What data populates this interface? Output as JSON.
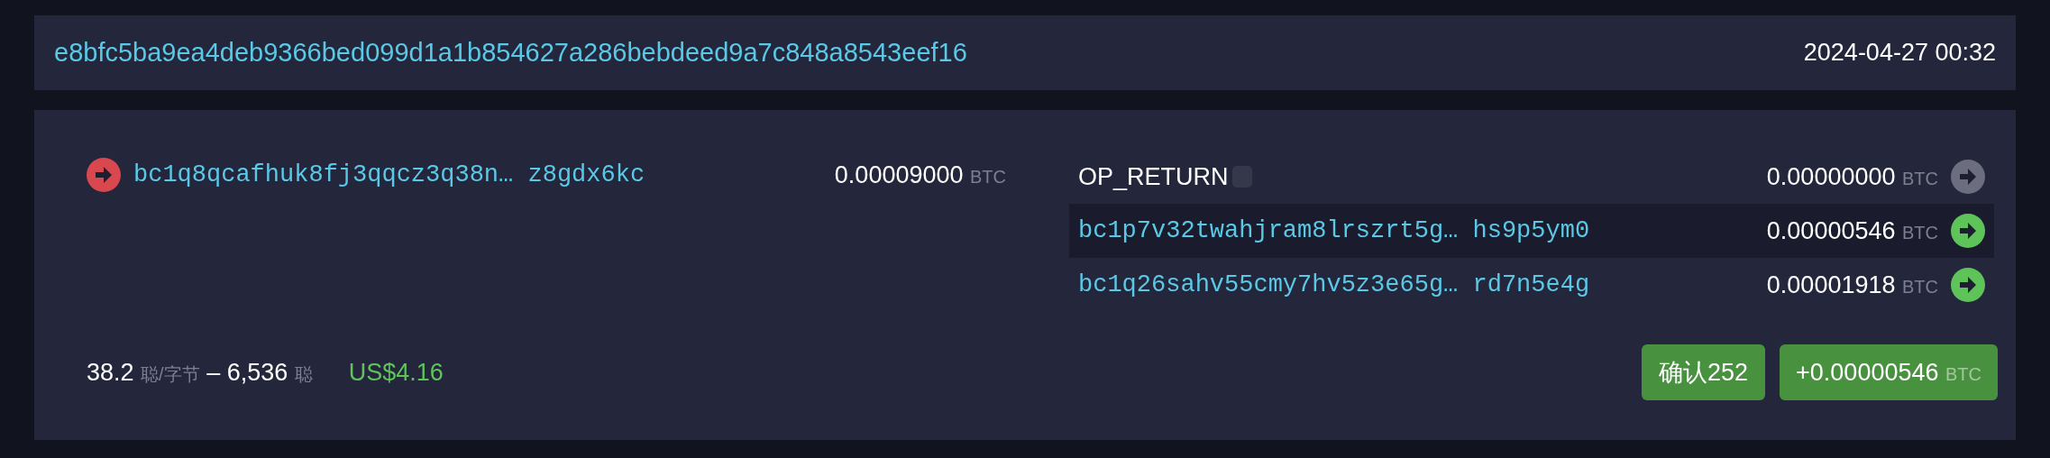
{
  "header": {
    "txid": "e8bfc5ba9ea4deb9366bed099d1a1b854627a286bebdeed9a7c848a8543eef16",
    "time": "2024-04-27 00:32"
  },
  "inputs": [
    {
      "address": "bc1q8qcafhuk8fj3qqcz3q38n…",
      "address_tail": "z8gdx6kc",
      "amount": "0.00009000",
      "unit": "BTC",
      "color": "#d9484f"
    }
  ],
  "outputs": [
    {
      "kind": "op_return",
      "label": "OP_RETURN",
      "amount": "0.00000000",
      "unit": "BTC",
      "color": "#6c6e80",
      "selected": false
    },
    {
      "kind": "address",
      "address": "bc1p7v32twahjram8lrszrt5g…",
      "address_tail": "hs9p5ym0",
      "amount": "0.00000546",
      "unit": "BTC",
      "color": "#5ec45a",
      "selected": true
    },
    {
      "kind": "address",
      "address": "bc1q26sahv55cmy7hv5z3e65g…",
      "address_tail": "rd7n5e4g",
      "amount": "0.00001918",
      "unit": "BTC",
      "color": "#5ec45a",
      "selected": false
    }
  ],
  "footer": {
    "fee_rate": "38.2",
    "fee_rate_unit": "聪/字节",
    "dash": "–",
    "fee": "6,536",
    "fee_unit": "聪",
    "fiat": "US$4.16",
    "confirmations": "确认252",
    "total": "+0.00000546",
    "total_unit": "BTC"
  }
}
